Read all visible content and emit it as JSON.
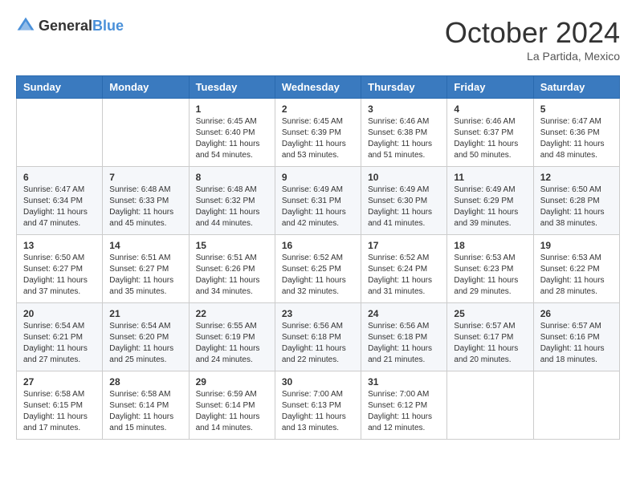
{
  "header": {
    "logo_general": "General",
    "logo_blue": "Blue",
    "month_title": "October 2024",
    "location": "La Partida, Mexico"
  },
  "weekdays": [
    "Sunday",
    "Monday",
    "Tuesday",
    "Wednesday",
    "Thursday",
    "Friday",
    "Saturday"
  ],
  "weeks": [
    [
      {
        "day": "",
        "info": ""
      },
      {
        "day": "",
        "info": ""
      },
      {
        "day": "1",
        "info": "Sunrise: 6:45 AM\nSunset: 6:40 PM\nDaylight: 11 hours and 54 minutes."
      },
      {
        "day": "2",
        "info": "Sunrise: 6:45 AM\nSunset: 6:39 PM\nDaylight: 11 hours and 53 minutes."
      },
      {
        "day": "3",
        "info": "Sunrise: 6:46 AM\nSunset: 6:38 PM\nDaylight: 11 hours and 51 minutes."
      },
      {
        "day": "4",
        "info": "Sunrise: 6:46 AM\nSunset: 6:37 PM\nDaylight: 11 hours and 50 minutes."
      },
      {
        "day": "5",
        "info": "Sunrise: 6:47 AM\nSunset: 6:36 PM\nDaylight: 11 hours and 48 minutes."
      }
    ],
    [
      {
        "day": "6",
        "info": "Sunrise: 6:47 AM\nSunset: 6:34 PM\nDaylight: 11 hours and 47 minutes."
      },
      {
        "day": "7",
        "info": "Sunrise: 6:48 AM\nSunset: 6:33 PM\nDaylight: 11 hours and 45 minutes."
      },
      {
        "day": "8",
        "info": "Sunrise: 6:48 AM\nSunset: 6:32 PM\nDaylight: 11 hours and 44 minutes."
      },
      {
        "day": "9",
        "info": "Sunrise: 6:49 AM\nSunset: 6:31 PM\nDaylight: 11 hours and 42 minutes."
      },
      {
        "day": "10",
        "info": "Sunrise: 6:49 AM\nSunset: 6:30 PM\nDaylight: 11 hours and 41 minutes."
      },
      {
        "day": "11",
        "info": "Sunrise: 6:49 AM\nSunset: 6:29 PM\nDaylight: 11 hours and 39 minutes."
      },
      {
        "day": "12",
        "info": "Sunrise: 6:50 AM\nSunset: 6:28 PM\nDaylight: 11 hours and 38 minutes."
      }
    ],
    [
      {
        "day": "13",
        "info": "Sunrise: 6:50 AM\nSunset: 6:27 PM\nDaylight: 11 hours and 37 minutes."
      },
      {
        "day": "14",
        "info": "Sunrise: 6:51 AM\nSunset: 6:27 PM\nDaylight: 11 hours and 35 minutes."
      },
      {
        "day": "15",
        "info": "Sunrise: 6:51 AM\nSunset: 6:26 PM\nDaylight: 11 hours and 34 minutes."
      },
      {
        "day": "16",
        "info": "Sunrise: 6:52 AM\nSunset: 6:25 PM\nDaylight: 11 hours and 32 minutes."
      },
      {
        "day": "17",
        "info": "Sunrise: 6:52 AM\nSunset: 6:24 PM\nDaylight: 11 hours and 31 minutes."
      },
      {
        "day": "18",
        "info": "Sunrise: 6:53 AM\nSunset: 6:23 PM\nDaylight: 11 hours and 29 minutes."
      },
      {
        "day": "19",
        "info": "Sunrise: 6:53 AM\nSunset: 6:22 PM\nDaylight: 11 hours and 28 minutes."
      }
    ],
    [
      {
        "day": "20",
        "info": "Sunrise: 6:54 AM\nSunset: 6:21 PM\nDaylight: 11 hours and 27 minutes."
      },
      {
        "day": "21",
        "info": "Sunrise: 6:54 AM\nSunset: 6:20 PM\nDaylight: 11 hours and 25 minutes."
      },
      {
        "day": "22",
        "info": "Sunrise: 6:55 AM\nSunset: 6:19 PM\nDaylight: 11 hours and 24 minutes."
      },
      {
        "day": "23",
        "info": "Sunrise: 6:56 AM\nSunset: 6:18 PM\nDaylight: 11 hours and 22 minutes."
      },
      {
        "day": "24",
        "info": "Sunrise: 6:56 AM\nSunset: 6:18 PM\nDaylight: 11 hours and 21 minutes."
      },
      {
        "day": "25",
        "info": "Sunrise: 6:57 AM\nSunset: 6:17 PM\nDaylight: 11 hours and 20 minutes."
      },
      {
        "day": "26",
        "info": "Sunrise: 6:57 AM\nSunset: 6:16 PM\nDaylight: 11 hours and 18 minutes."
      }
    ],
    [
      {
        "day": "27",
        "info": "Sunrise: 6:58 AM\nSunset: 6:15 PM\nDaylight: 11 hours and 17 minutes."
      },
      {
        "day": "28",
        "info": "Sunrise: 6:58 AM\nSunset: 6:14 PM\nDaylight: 11 hours and 15 minutes."
      },
      {
        "day": "29",
        "info": "Sunrise: 6:59 AM\nSunset: 6:14 PM\nDaylight: 11 hours and 14 minutes."
      },
      {
        "day": "30",
        "info": "Sunrise: 7:00 AM\nSunset: 6:13 PM\nDaylight: 11 hours and 13 minutes."
      },
      {
        "day": "31",
        "info": "Sunrise: 7:00 AM\nSunset: 6:12 PM\nDaylight: 11 hours and 12 minutes."
      },
      {
        "day": "",
        "info": ""
      },
      {
        "day": "",
        "info": ""
      }
    ]
  ]
}
